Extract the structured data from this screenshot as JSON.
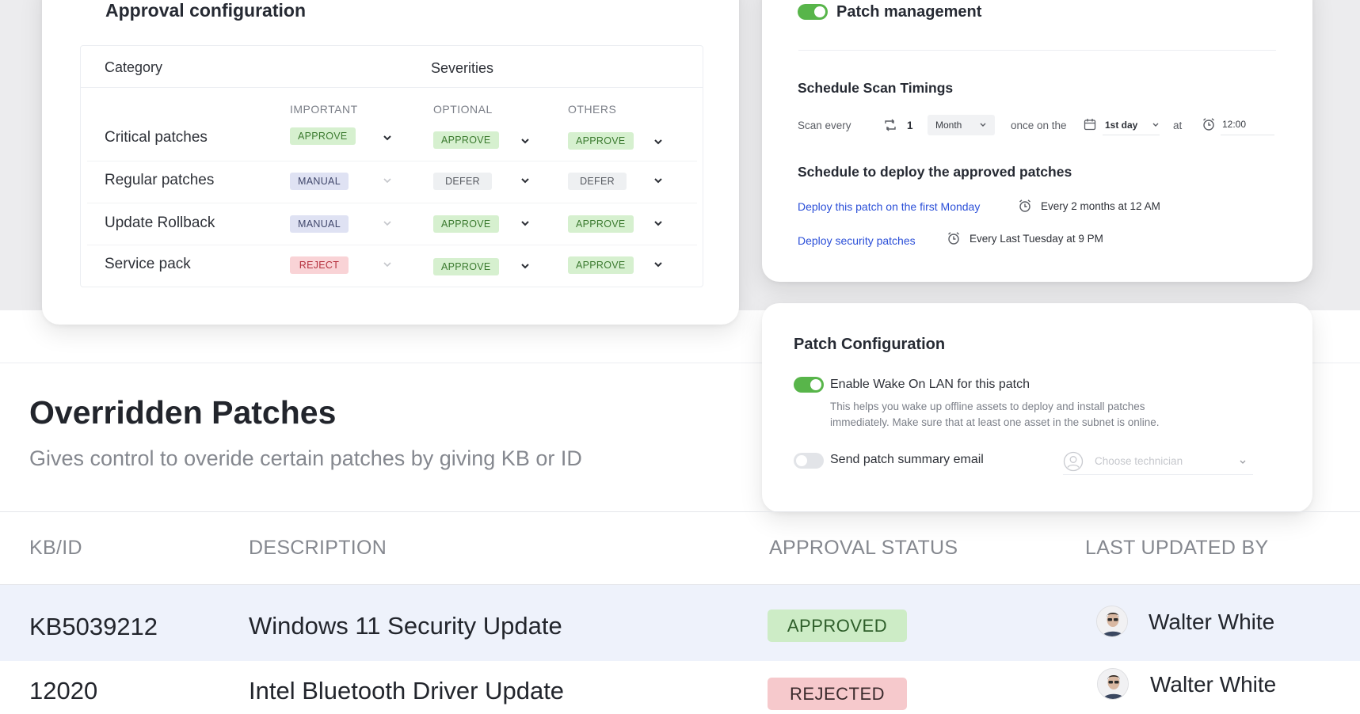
{
  "approval": {
    "title": "Approval configuration",
    "category_header": "Category",
    "severities_header": "Severities",
    "severity_columns": [
      "IMPORTANT",
      "OPTIONAL",
      "OTHERS"
    ],
    "rows": [
      {
        "category": "Critical patches",
        "values": [
          "APPROVE",
          "APPROVE",
          "APPROVE"
        ]
      },
      {
        "category": "Regular patches",
        "values": [
          "MANUAL",
          "DEFER",
          "DEFER"
        ]
      },
      {
        "category": "Update Rollback",
        "values": [
          "MANUAL",
          "APPROVE",
          "APPROVE"
        ]
      },
      {
        "category": "Service pack",
        "values": [
          "REJECT",
          "APPROVE",
          "APPROVE"
        ]
      }
    ]
  },
  "patch_management": {
    "toggle_label": "Patch management",
    "toggle_on": true,
    "scan_title": "Schedule Scan Timings",
    "scan_every_label": "Scan every",
    "scan_interval": "1",
    "scan_unit": "Month",
    "once_on_label": "once on the",
    "scan_day": "1st day",
    "at_label": "at",
    "scan_time": "12:00",
    "deploy_title": "Schedule to deploy the approved patches",
    "deploy_rules": [
      {
        "link": "Deploy this patch on the first Monday",
        "schedule": "Every 2 months at 12 AM"
      },
      {
        "link": "Deploy security patches",
        "schedule": "Every Last Tuesday at 9 PM"
      }
    ]
  },
  "patch_config": {
    "title": "Patch Configuration",
    "wol_label": "Enable Wake On LAN for this patch",
    "wol_on": true,
    "wol_help_1": "This helps you wake up offline assets to deploy and install patches",
    "wol_help_2": "immediately. Make sure that at least one asset in the subnet is online.",
    "email_label": "Send patch summary email",
    "email_on": false,
    "technician_placeholder": "Choose technician"
  },
  "overridden": {
    "title": "Overridden Patches",
    "subtitle": "Gives control to overide certain patches by giving KB or ID",
    "columns": [
      "KB/ID",
      "DESCRIPTION",
      "APPROVAL STATUS",
      "LAST UPDATED BY"
    ],
    "rows": [
      {
        "id": "KB5039212",
        "description": "Windows 11  Security Update",
        "status": "APPROVED",
        "user": "Walter White"
      },
      {
        "id": "12020",
        "description": "Intel Bluetooth Driver Update",
        "status": "REJECTED",
        "user": "Walter White"
      }
    ]
  },
  "colors": {
    "toggle_on": "#58b54a",
    "approve": "#d6f0cf",
    "reject": "#f9d3d6",
    "manual": "#dfe2f3",
    "link": "#2b4fd8"
  }
}
